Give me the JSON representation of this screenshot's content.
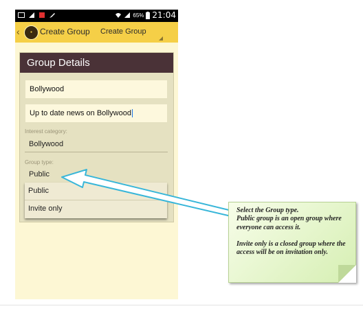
{
  "status_bar": {
    "battery_percent": "65%",
    "time": "21:04"
  },
  "action_bar": {
    "title": "Create Group",
    "action_label": "Create Group"
  },
  "card": {
    "header": "Group Details",
    "group_name_value": "Bollywood",
    "description_value": "Up to date news on Bollywood",
    "interest_category_label": "Interest category:",
    "interest_category_value": "Bollywood",
    "group_type_label": "Group type:",
    "group_type_value": "Public"
  },
  "dropdown": {
    "options": [
      "Public",
      "Invite only"
    ]
  },
  "callout": {
    "line1": "Select the Group type.",
    "line2": "Public group is an open group where everyone can access it.",
    "line3": "Invite only is a closed group where the access will be on invitation only."
  },
  "colors": {
    "action_bar": "#f5cf47",
    "card_header": "#4a3237",
    "screen_background": "#fdf7d4",
    "callout_green": "#d6efb3",
    "arrow_outline": "#38b6d9"
  }
}
